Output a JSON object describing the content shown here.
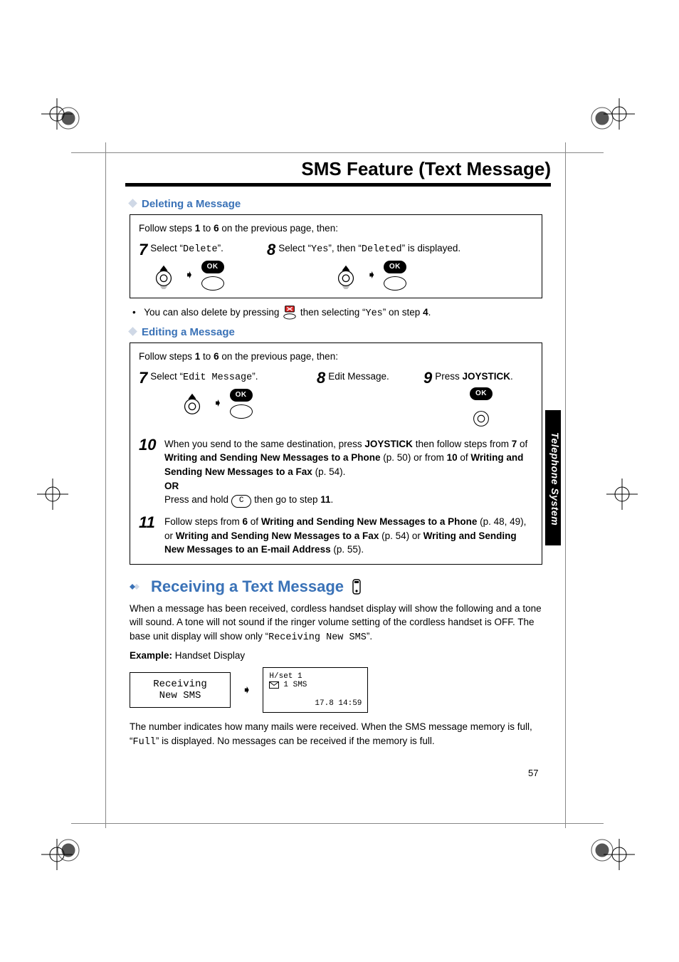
{
  "header": {
    "title": "SMS Feature (Text Message)"
  },
  "sideTab": "Telephone System",
  "pageNumber": "57",
  "del": {
    "heading": "Deleting a Message",
    "follow_a": "Follow steps ",
    "follow_b": " to ",
    "follow_c": " on the previous page, then:",
    "n1": "1",
    "n6": "6",
    "s7num": "7",
    "s7a": "Select “",
    "s7code": "Delete",
    "s7b": "”.",
    "s8num": "8",
    "s8a": "Select “",
    "s8code1": "Yes",
    "s8b": "”, then “",
    "s8code2": "Deleted",
    "s8c": "” is displayed.",
    "ok": "OK",
    "note_a": "You can also delete by pressing ",
    "note_b": " then selecting “",
    "note_code": "Yes",
    "note_c": "” on step ",
    "note_bold": "4",
    "note_d": "."
  },
  "edit": {
    "heading": "Editing a Message",
    "follow_a": "Follow steps ",
    "follow_b": " to ",
    "follow_c": " on the previous page, then:",
    "n1": "1",
    "n6": "6",
    "s7num": "7",
    "s7a": "Select “",
    "s7code": "Edit Message",
    "s7b": "”.",
    "s8num": "8",
    "s8": "Edit Message.",
    "s9num": "9",
    "s9a": "Press ",
    "s9b": "JOYSTICK",
    "s9c": ".",
    "ok": "OK",
    "s10num": "10",
    "s10_a": "When you send to the same destination, press ",
    "s10_joy": "JOYSTICK",
    "s10_b": " then follow steps from ",
    "s10_7": "7",
    "s10_c": " of ",
    "s10_ref1": "Writing and Sending New Messages to a Phone",
    "s10_d": " (p. 50) or from ",
    "s10_10": "10",
    "s10_e": " of ",
    "s10_ref2": "Writing and Sending New Messages to a Fax",
    "s10_f": " (p. 54).",
    "s10_or": "OR",
    "s10_g": "Press and hold ",
    "s10_cbtn": "C",
    "s10_h": " then go to step ",
    "s10_11": "11",
    "s10_i": ".",
    "s11num": "11",
    "s11_a": "Follow steps from ",
    "s11_6": "6",
    "s11_b": " of ",
    "s11_ref1": "Writing and Sending New Messages to a Phone",
    "s11_c": " (p. 48, 49), or ",
    "s11_ref2": "Writing and Sending New Messages to a Fax",
    "s11_d": " (p. 54) or ",
    "s11_ref3": "Writing and Sending New Messages to an E-mail Address",
    "s11_e": " (p. 55)."
  },
  "recv": {
    "heading": "Receiving a Text Message",
    "p1_a": "When a message has been received, cordless handset display will show the following and a tone will sound. A tone will not sound if the ringer volume setting of the cordless handset is OFF. The base unit display will show only “",
    "p1_code": "Receiving New SMS",
    "p1_b": "”.",
    "example_label_a": "Example:",
    "example_label_b": " Handset Display",
    "lcd1_l1": "Receiving",
    "lcd1_l2": "New SMS",
    "lcd2_l1": "H/set 1",
    "lcd2_l2": "1 SMS",
    "lcd2_l3": "17.8 14:59",
    "p2_a": "The number indicates how many mails were received. When the SMS message memory is full, “",
    "p2_code": "Full",
    "p2_b": "” is displayed. No messages can be received if the memory is full."
  }
}
